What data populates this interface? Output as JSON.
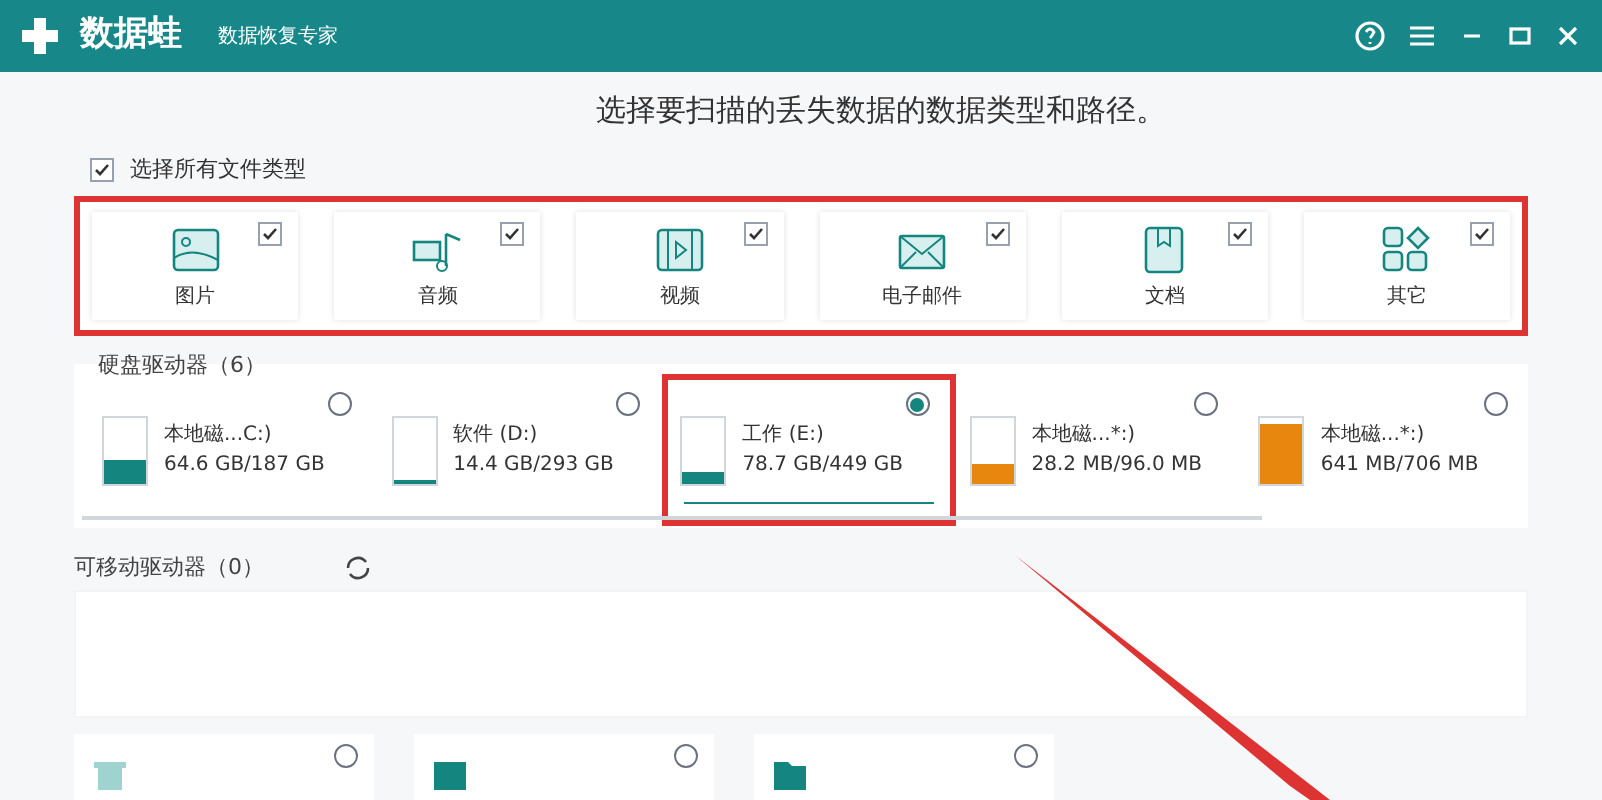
{
  "window": {
    "app_name": "数据蛙",
    "subtitle": "数据恢复专家"
  },
  "heading": "选择要扫描的丢失数据的数据类型和路径。",
  "select_all": {
    "label": "选择所有文件类型",
    "checked": true
  },
  "file_types": [
    {
      "kind": "image",
      "label": "图片",
      "checked": true
    },
    {
      "kind": "audio",
      "label": "音频",
      "checked": true
    },
    {
      "kind": "video",
      "label": "视频",
      "checked": true
    },
    {
      "kind": "email",
      "label": "电子邮件",
      "checked": true
    },
    {
      "kind": "document",
      "label": "文档",
      "checked": true
    },
    {
      "kind": "other",
      "label": "其它",
      "checked": true
    }
  ],
  "hard_drives": {
    "title": "硬盘驱动器（6）",
    "drives": [
      {
        "name": "本地磁...C:)",
        "size": "64.6 GB/187 GB",
        "level": 0.35,
        "color": "#15857f",
        "selected": false
      },
      {
        "name": "软件 (D:)",
        "size": "14.4 GB/293 GB",
        "level": 0.05,
        "color": "#15857f",
        "selected": false
      },
      {
        "name": "工作 (E:)",
        "size": "78.7 GB/449 GB",
        "level": 0.18,
        "color": "#15857f",
        "selected": true
      },
      {
        "name": "本地磁...*:)",
        "size": "28.2 MB/96.0 MB",
        "level": 0.3,
        "color": "#e8870e",
        "selected": false
      },
      {
        "name": "本地磁...*:)",
        "size": "641 MB/706 MB",
        "level": 0.9,
        "color": "#e8870e",
        "selected": false
      }
    ]
  },
  "removable_drives": {
    "title": "可移动驱动器（0）"
  },
  "locations": [
    {
      "kind": "recycle",
      "selected": false
    },
    {
      "kind": "desktop",
      "selected": false
    },
    {
      "kind": "folder",
      "selected": false
    }
  ]
}
